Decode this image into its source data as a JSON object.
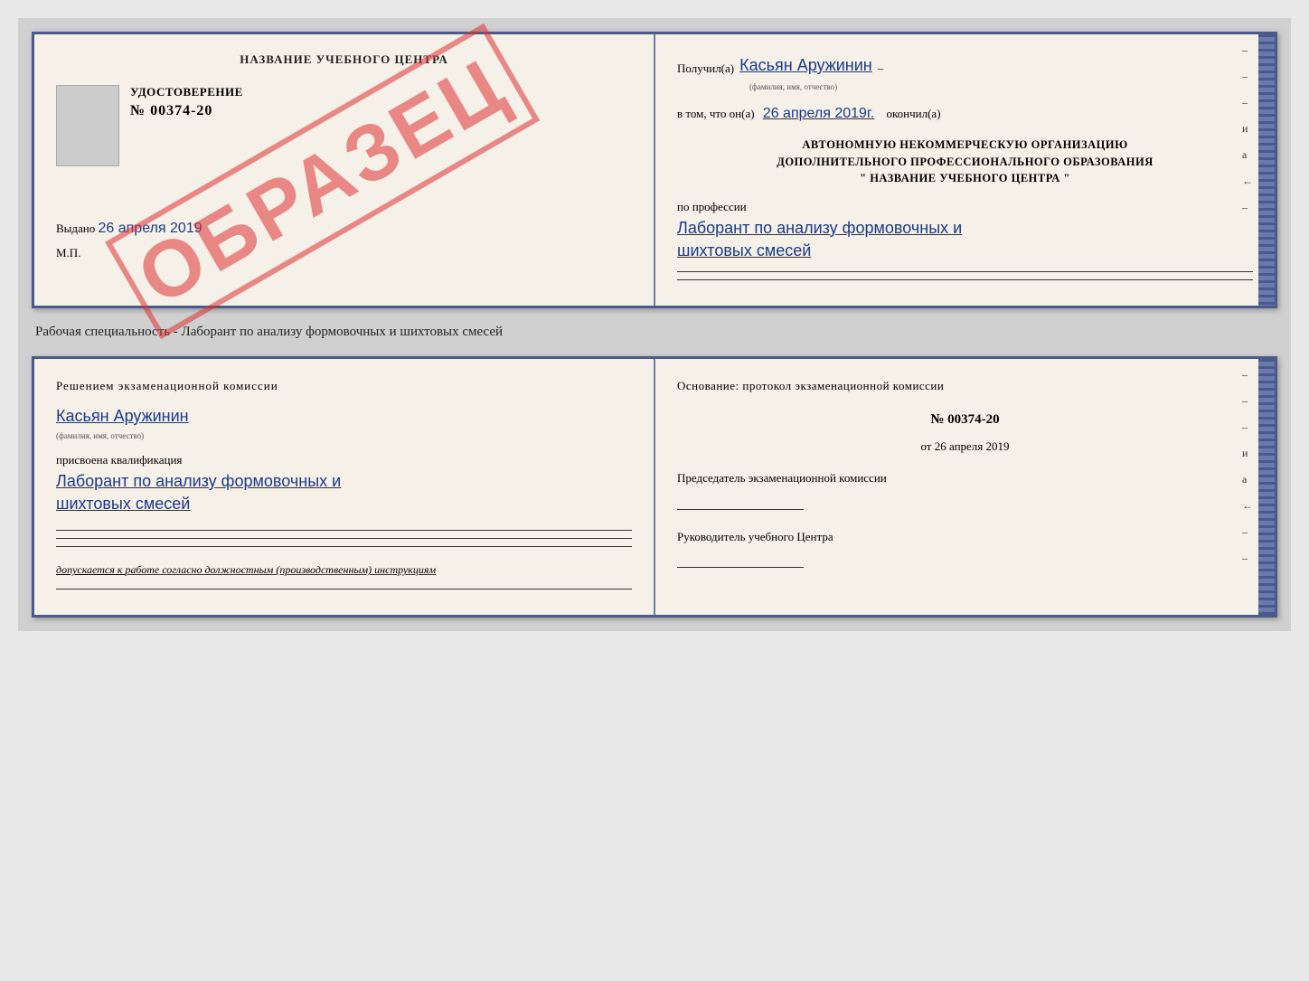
{
  "top_document": {
    "left": {
      "title": "НАЗВАНИЕ УЧЕБНОГО ЦЕНТРА",
      "watermark": "ОБРАЗЕЦ",
      "udost_label": "УДОСТОВЕРЕНИЕ",
      "udost_number": "№ 00374-20",
      "vydano": "Выдано",
      "vydano_date": "26 апреля 2019",
      "mp": "М.П."
    },
    "right": {
      "poluchil": "Получил(а)",
      "name_handwritten": "Касьян Аружинин",
      "name_sub": "(фамилия, имя, отчество)",
      "dash": "–",
      "vtom": "в том, что он(а)",
      "date_handwritten": "26 апреля 2019г.",
      "okonchil": "окончил(а)",
      "org_line1": "АВТОНОМНУЮ НЕКОММЕРЧЕСКУЮ ОРГАНИЗАЦИЮ",
      "org_line2": "ДОПОЛНИТЕЛЬНОГО ПРОФЕССИОНАЛЬНОГО ОБРАЗОВАНИЯ",
      "org_line3": "\" НАЗВАНИЕ УЧЕБНОГО ЦЕНТРА \"",
      "po_professii": "по профессии",
      "prof_handwritten1": "Лаборант по анализу формовочных и",
      "prof_handwritten2": "шихтовых смесей",
      "side_marks": [
        "–",
        "–",
        "–",
        "и",
        "а",
        "←",
        "–"
      ]
    }
  },
  "specialty_line": "Рабочая специальность - Лаборант по анализу формовочных и шихтовых смесей",
  "bottom_document": {
    "left": {
      "resheniem": "Решением экзаменационной комиссии",
      "name_handwritten": "Касьян Аружинин",
      "name_sub": "(фамилия, имя, отчество)",
      "prisvoena": "присвоена квалификация",
      "qual_handwritten1": "Лаборант по анализу формовочных и",
      "qual_handwritten2": "шихтовых смесей",
      "dopuskaetsya_label": "допускается к",
      "dopuskaetsya_text": "работе согласно должностным (производственным) инструкциям"
    },
    "right": {
      "osnovanie": "Основание: протокол экзаменационной комиссии",
      "number_label": "№",
      "number": "00374-20",
      "ot_label": "от",
      "ot_date": "26 апреля 2019",
      "predsedatel_label": "Председатель экзаменационной комиссии",
      "rukovoditel_label": "Руководитель учебного Центра",
      "side_marks": [
        "–",
        "–",
        "–",
        "и",
        "а",
        "←",
        "–",
        "–"
      ]
    }
  }
}
